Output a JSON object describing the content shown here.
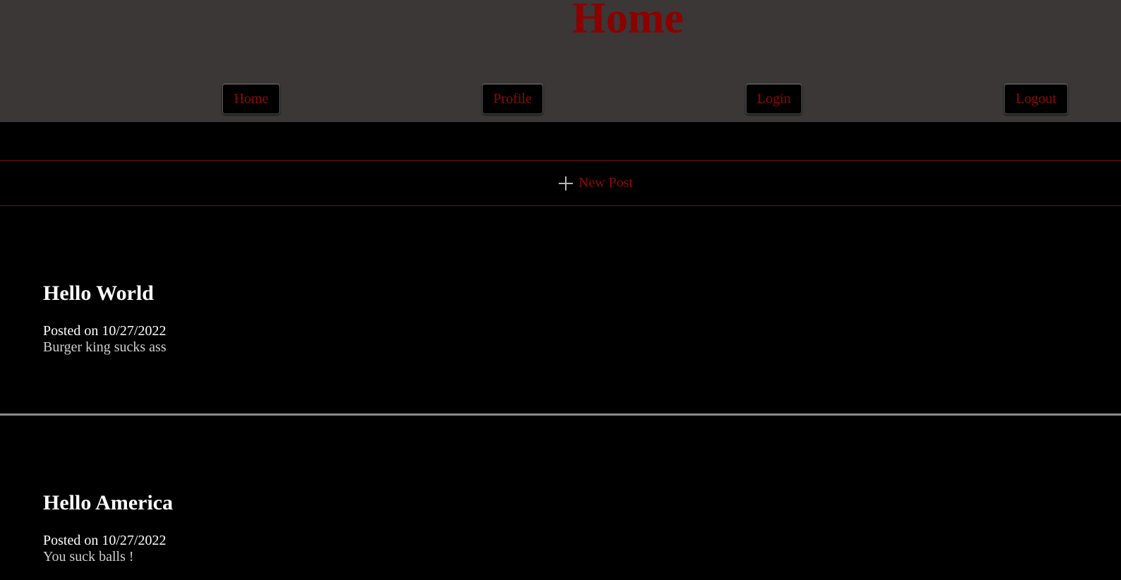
{
  "header": {
    "title": "Home",
    "title_color": "#8b0000",
    "background": "#3b3737"
  },
  "nav": {
    "items": [
      {
        "label": "Home"
      },
      {
        "label": "Profile"
      },
      {
        "label": "Login"
      },
      {
        "label": "Logout"
      }
    ],
    "label_color": "#8b0a0a"
  },
  "new_post": {
    "icon": "plus-icon",
    "label": "New Post"
  },
  "posts": [
    {
      "title": "Hello World",
      "date": "Posted on 10/27/2022",
      "body": "Burger king sucks ass"
    },
    {
      "title": "Hello America",
      "date": "Posted on 10/27/2022",
      "body": "You suck balls !"
    }
  ]
}
